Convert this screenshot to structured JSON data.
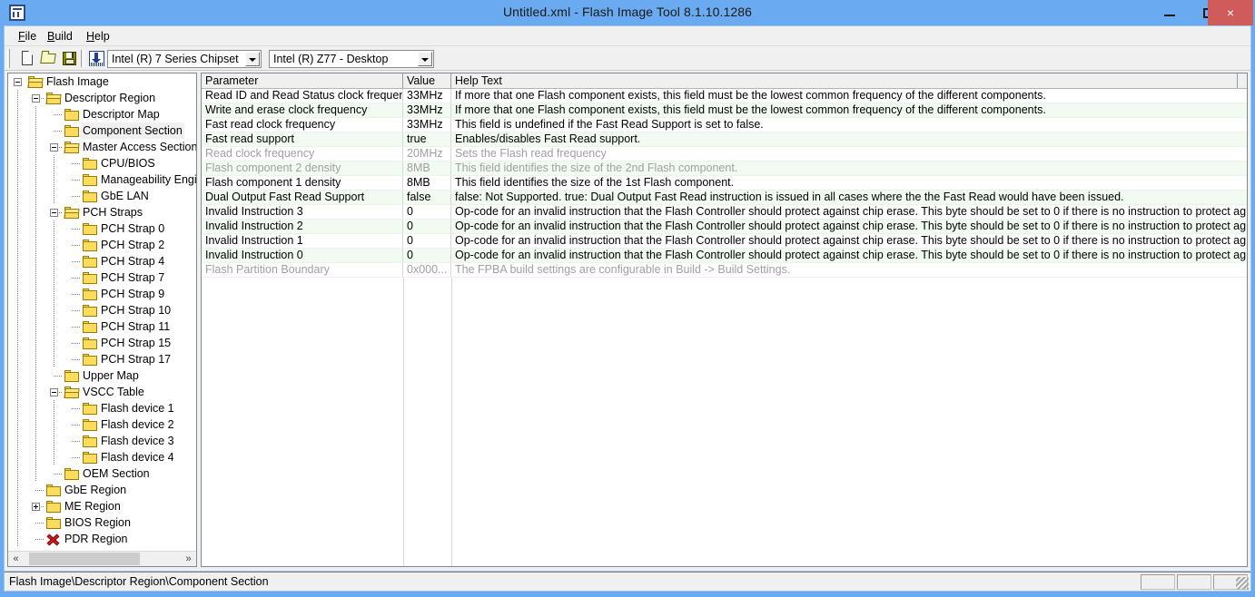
{
  "window": {
    "title": "Untitled.xml - Flash Image Tool 8.1.10.1286",
    "app_icon": "flash-image-tool-icon",
    "minimize_label": "",
    "maximize_label": "",
    "close_label": "×",
    "titlebar_color": "#6aaaf0",
    "close_button_color": "#d05b5b"
  },
  "menu": {
    "items": [
      {
        "label": "File",
        "mnemonic": "F"
      },
      {
        "label": "Build",
        "mnemonic": "B"
      },
      {
        "label": "Help",
        "mnemonic": "H"
      }
    ]
  },
  "toolbar": {
    "buttons": [
      {
        "name": "new-file-button",
        "icon": "new-document-icon"
      },
      {
        "name": "open-file-button",
        "icon": "open-folder-icon"
      },
      {
        "name": "save-file-button",
        "icon": "floppy-disk-save-icon"
      },
      {
        "name": "build-image-button",
        "icon": "build-download-icon"
      }
    ],
    "chipset_combo": {
      "value": "Intel (R) 7 Series Chipset",
      "options": [
        "Intel (R) 7 Series Chipset"
      ]
    },
    "sku_combo": {
      "value": "Intel (R) Z77 - Desktop",
      "options": [
        "Intel (R) Z77 - Desktop"
      ]
    }
  },
  "tree": {
    "nodes": [
      {
        "label": "Flash Image",
        "depth": 0,
        "expander": "minus",
        "icon": "folder-open-icon",
        "selected": false
      },
      {
        "label": "Descriptor Region",
        "depth": 1,
        "expander": "minus",
        "icon": "folder-open-icon",
        "selected": false
      },
      {
        "label": "Descriptor Map",
        "depth": 2,
        "expander": "none",
        "icon": "folder-closed-icon",
        "selected": false
      },
      {
        "label": "Component Section",
        "depth": 2,
        "expander": "none",
        "icon": "folder-closed-icon",
        "selected": true
      },
      {
        "label": "Master Access Section",
        "depth": 2,
        "expander": "minus",
        "icon": "folder-open-icon",
        "selected": false
      },
      {
        "label": "CPU/BIOS",
        "depth": 3,
        "expander": "none",
        "icon": "folder-closed-icon",
        "selected": false
      },
      {
        "label": "Manageability Engin",
        "depth": 3,
        "expander": "none",
        "icon": "folder-closed-icon",
        "selected": false
      },
      {
        "label": "GbE LAN",
        "depth": 3,
        "expander": "none",
        "icon": "folder-closed-icon",
        "selected": false
      },
      {
        "label": "PCH Straps",
        "depth": 2,
        "expander": "minus",
        "icon": "folder-open-icon",
        "selected": false
      },
      {
        "label": "PCH Strap 0",
        "depth": 3,
        "expander": "none",
        "icon": "folder-closed-icon",
        "selected": false
      },
      {
        "label": "PCH Strap 2",
        "depth": 3,
        "expander": "none",
        "icon": "folder-closed-icon",
        "selected": false
      },
      {
        "label": "PCH Strap 4",
        "depth": 3,
        "expander": "none",
        "icon": "folder-closed-icon",
        "selected": false
      },
      {
        "label": "PCH Strap 7",
        "depth": 3,
        "expander": "none",
        "icon": "folder-closed-icon",
        "selected": false
      },
      {
        "label": "PCH Strap 9",
        "depth": 3,
        "expander": "none",
        "icon": "folder-closed-icon",
        "selected": false
      },
      {
        "label": "PCH Strap 10",
        "depth": 3,
        "expander": "none",
        "icon": "folder-closed-icon",
        "selected": false
      },
      {
        "label": "PCH Strap 11",
        "depth": 3,
        "expander": "none",
        "icon": "folder-closed-icon",
        "selected": false
      },
      {
        "label": "PCH Strap 15",
        "depth": 3,
        "expander": "none",
        "icon": "folder-closed-icon",
        "selected": false
      },
      {
        "label": "PCH Strap 17",
        "depth": 3,
        "expander": "none",
        "icon": "folder-closed-icon",
        "selected": false
      },
      {
        "label": "Upper Map",
        "depth": 2,
        "expander": "none",
        "icon": "folder-closed-icon",
        "selected": false
      },
      {
        "label": "VSCC Table",
        "depth": 2,
        "expander": "minus",
        "icon": "folder-open-icon",
        "selected": false
      },
      {
        "label": "Flash device 1",
        "depth": 3,
        "expander": "none",
        "icon": "folder-closed-icon",
        "selected": false
      },
      {
        "label": "Flash device 2",
        "depth": 3,
        "expander": "none",
        "icon": "folder-closed-icon",
        "selected": false
      },
      {
        "label": "Flash device 3",
        "depth": 3,
        "expander": "none",
        "icon": "folder-closed-icon",
        "selected": false
      },
      {
        "label": "Flash device 4",
        "depth": 3,
        "expander": "none",
        "icon": "folder-closed-icon",
        "selected": false
      },
      {
        "label": "OEM Section",
        "depth": 2,
        "expander": "none",
        "icon": "folder-closed-icon",
        "selected": false
      },
      {
        "label": "GbE Region",
        "depth": 1,
        "expander": "none",
        "icon": "folder-closed-icon",
        "selected": false
      },
      {
        "label": "ME Region",
        "depth": 1,
        "expander": "plus",
        "icon": "folder-closed-icon",
        "selected": false
      },
      {
        "label": "BIOS Region",
        "depth": 1,
        "expander": "none",
        "icon": "folder-closed-icon",
        "selected": false
      },
      {
        "label": "PDR Region",
        "depth": 1,
        "expander": "none",
        "icon": "red-x-icon",
        "selected": false
      }
    ],
    "hscroll": {
      "left_arrow": "«",
      "right_arrow": "»"
    }
  },
  "grid": {
    "columns": [
      "Parameter",
      "Value",
      "Help Text"
    ],
    "rows": [
      {
        "parameter": "Read ID and Read Status clock frequency",
        "value": "33MHz",
        "help": "If more that one Flash component exists, this field must be the lowest common frequency of the different components.",
        "disabled": false
      },
      {
        "parameter": "Write and erase clock frequency",
        "value": "33MHz",
        "help": "If more that one Flash component exists, this field must be the lowest common frequency of the different components.",
        "disabled": false
      },
      {
        "parameter": "Fast read clock frequency",
        "value": "33MHz",
        "help": "This field is undefined if the Fast Read Support is set to false.",
        "disabled": false
      },
      {
        "parameter": "Fast read support",
        "value": "true",
        "help": "Enables/disables Fast Read support.",
        "disabled": false
      },
      {
        "parameter": "Read clock frequency",
        "value": "20MHz",
        "help": "Sets the Flash read frequency",
        "disabled": true
      },
      {
        "parameter": "Flash component 2 density",
        "value": "8MB",
        "help": "This field identifies the size of the 2nd Flash component.",
        "disabled": true
      },
      {
        "parameter": "Flash component 1 density",
        "value": "8MB",
        "help": "This field identifies the size of the 1st Flash component.",
        "disabled": false
      },
      {
        "parameter": "Dual Output Fast Read Support",
        "value": "false",
        "help": "false: Not Supported. true: Dual Output Fast Read instruction is issued in all cases where the the Fast Read would have been issued.",
        "disabled": false
      },
      {
        "parameter": "Invalid Instruction 3",
        "value": "0",
        "help": "Op-code for an invalid instruction that the Flash Controller should protect against chip erase. This byte should be set to 0 if there is no instruction to protect against.",
        "disabled": false
      },
      {
        "parameter": "Invalid Instruction 2",
        "value": "0",
        "help": "Op-code for an invalid instruction that the Flash Controller should protect against chip erase. This byte should be set to 0 if there is no instruction to protect against.",
        "disabled": false
      },
      {
        "parameter": "Invalid Instruction 1",
        "value": "0",
        "help": "Op-code for an invalid instruction that the Flash Controller should protect against chip erase. This byte should be set to 0 if there is no instruction to protect against.",
        "disabled": false
      },
      {
        "parameter": "Invalid Instruction 0",
        "value": "0",
        "help": "Op-code for an invalid instruction that the Flash Controller should protect against chip erase. This byte should be set to 0 if there is no instruction to protect against.",
        "disabled": false
      },
      {
        "parameter": "Flash Partition Boundary",
        "value": "0x000...",
        "help": "The FPBA build settings are configurable in Build -> Build Settings.",
        "disabled": true
      }
    ]
  },
  "statusbar": {
    "path": "Flash Image\\Descriptor Region\\Component Section",
    "panes": [
      "",
      "",
      ""
    ]
  }
}
